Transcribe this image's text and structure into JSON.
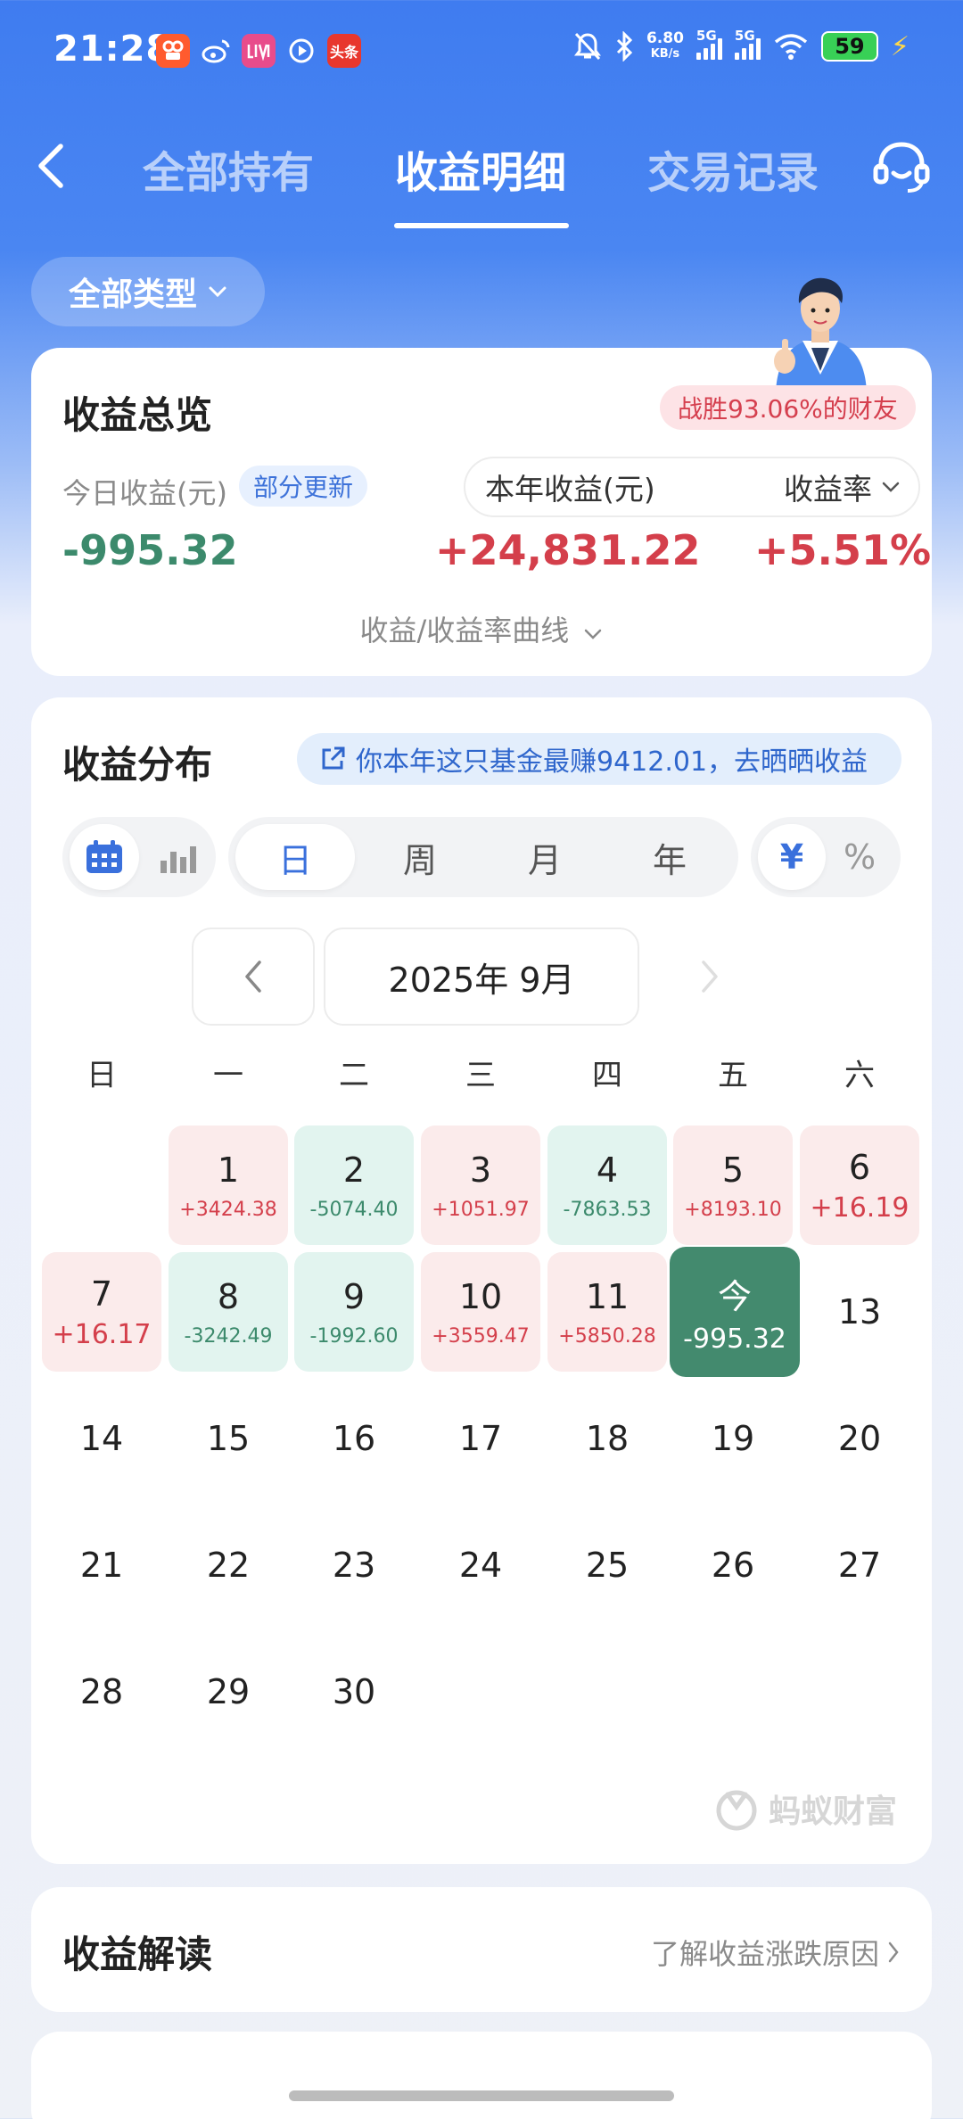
{
  "status_bar": {
    "time": "21:28",
    "net_speed_value": "6.80",
    "net_speed_unit": "KB/s",
    "signal_1_label": "5G",
    "signal_2_label": "5G",
    "battery_level": "59",
    "app_icons": [
      {
        "name": "kuaishou-icon",
        "glyph": "",
        "color": "#ff5b2e"
      },
      {
        "name": "weibo-icon",
        "glyph": "",
        "color": "transparent"
      },
      {
        "name": "lofter-icon",
        "glyph": "",
        "color": "#e84c8b"
      },
      {
        "name": "video-play-icon",
        "glyph": "",
        "color": "transparent"
      },
      {
        "name": "toutiao-icon",
        "glyph": "头条",
        "color": "#e8372d"
      }
    ]
  },
  "nav": {
    "tabs": [
      {
        "label": "全部持有",
        "active": false
      },
      {
        "label": "收益明细",
        "active": true
      },
      {
        "label": "交易记录",
        "active": false
      }
    ]
  },
  "filter": {
    "label": "全部类型"
  },
  "overview": {
    "title": "收益总览",
    "win_badge": "战胜93.06%的财友",
    "today_label": "今日收益(元)",
    "partial_badge": "部分更新",
    "year_label": "本年收益(元)",
    "rate_label": "收益率",
    "today_value": "-995.32",
    "year_value": "+24,831.22",
    "rate_value": "+5.51%",
    "curve_link": "收益/收益率曲线"
  },
  "distribution": {
    "title": "收益分布",
    "share_banner": "你本年这只基金最赚9412.01，去晒晒收益",
    "periods": [
      "日",
      "周",
      "月",
      "年"
    ],
    "active_period": "日",
    "units": [
      "¥",
      "%"
    ],
    "active_unit": "¥",
    "month_label": "2025年 9月",
    "weekdays": [
      "日",
      "一",
      "二",
      "三",
      "四",
      "五",
      "六"
    ],
    "watermark": "蚂蚁财富",
    "days": [
      {
        "day": "1",
        "value": "+3424.38",
        "trend": "up"
      },
      {
        "day": "2",
        "value": "-5074.40",
        "trend": "down"
      },
      {
        "day": "3",
        "value": "+1051.97",
        "trend": "up"
      },
      {
        "day": "4",
        "value": "-7863.53",
        "trend": "down"
      },
      {
        "day": "5",
        "value": "+8193.10",
        "trend": "up"
      },
      {
        "day": "6",
        "value": "+16.19",
        "trend": "up"
      },
      {
        "day": "7",
        "value": "+16.17",
        "trend": "up"
      },
      {
        "day": "8",
        "value": "-3242.49",
        "trend": "down"
      },
      {
        "day": "9",
        "value": "-1992.60",
        "trend": "down"
      },
      {
        "day": "10",
        "value": "+3559.47",
        "trend": "up"
      },
      {
        "day": "11",
        "value": "+5850.28",
        "trend": "up"
      },
      {
        "day": "今",
        "value": "-995.32",
        "trend": "today"
      },
      {
        "day": "13",
        "value": "",
        "trend": "none"
      },
      {
        "day": "14",
        "value": "",
        "trend": "none"
      },
      {
        "day": "15",
        "value": "",
        "trend": "none"
      },
      {
        "day": "16",
        "value": "",
        "trend": "none"
      },
      {
        "day": "17",
        "value": "",
        "trend": "none"
      },
      {
        "day": "18",
        "value": "",
        "trend": "none"
      },
      {
        "day": "19",
        "value": "",
        "trend": "none"
      },
      {
        "day": "20",
        "value": "",
        "trend": "none"
      },
      {
        "day": "21",
        "value": "",
        "trend": "none"
      },
      {
        "day": "22",
        "value": "",
        "trend": "none"
      },
      {
        "day": "23",
        "value": "",
        "trend": "none"
      },
      {
        "day": "24",
        "value": "",
        "trend": "none"
      },
      {
        "day": "25",
        "value": "",
        "trend": "none"
      },
      {
        "day": "26",
        "value": "",
        "trend": "none"
      },
      {
        "day": "27",
        "value": "",
        "trend": "none"
      },
      {
        "day": "28",
        "value": "",
        "trend": "none"
      },
      {
        "day": "29",
        "value": "",
        "trend": "none"
      },
      {
        "day": "30",
        "value": "",
        "trend": "none"
      }
    ]
  },
  "analysis": {
    "title": "收益解读",
    "link": "了解收益涨跌原因"
  },
  "colors": {
    "gain": "#d43f4b",
    "loss": "#3c8a6c",
    "accent": "#3a70dc",
    "header_bg": "#3f7cf0"
  }
}
